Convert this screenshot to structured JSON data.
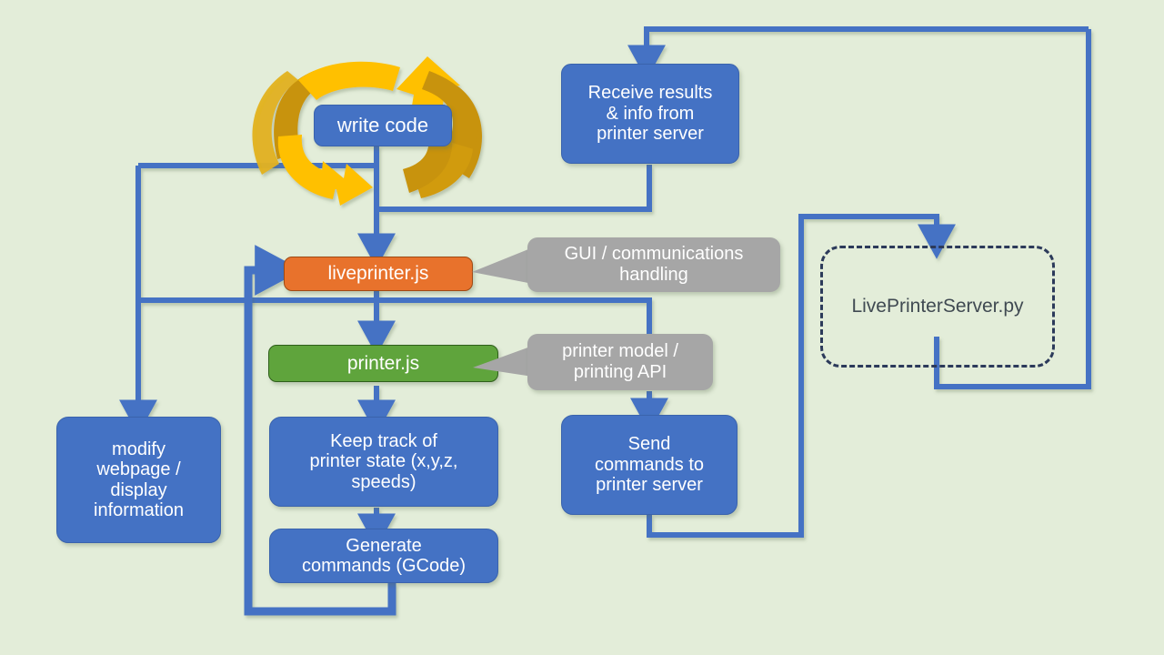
{
  "diagram": {
    "title": "LivePrinter architecture flow diagram",
    "background_color": "#e3edd9",
    "colors": {
      "blue": "#4472c4",
      "orange": "#e8722c",
      "green": "#5fa43c",
      "gray": "#a6a6a6",
      "yellow": "#ffc000",
      "dark_yellow": "#c8930a",
      "dashed_border": "#2c3a5a"
    }
  },
  "nodes": {
    "write_code": "write code",
    "receive_results": "Receive results\n& info from\nprinter server",
    "liveprinter_js": "liveprinter.js",
    "printer_js": "printer.js",
    "modify_webpage": "modify\nwebpage /\ndisplay\ninformation",
    "keep_track": "Keep track of\nprinter state (x,y,z,\nspeeds)",
    "generate_commands": "Generate\ncommands (GCode)",
    "send_commands": "Send\ncommands to\nprinter server",
    "server_py": "LivePrinterServer.py"
  },
  "callouts": {
    "gui_comms": "GUI / communications\nhandling",
    "printer_model": "printer model /\nprinting API"
  },
  "icons": {
    "cycle": "circular-refresh-arrows-icon"
  }
}
